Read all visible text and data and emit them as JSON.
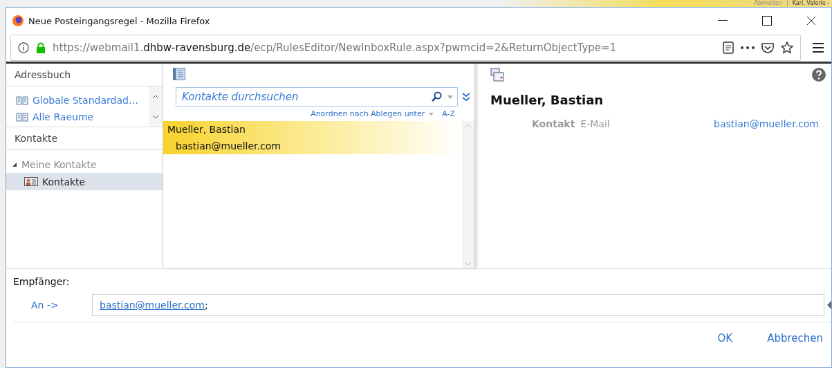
{
  "background_header": {
    "items": [
      "Abmelden",
      "|",
      "Karl, Valerie -"
    ]
  },
  "window": {
    "title": "Neue Posteingangsregel - Mozilla Firefox"
  },
  "address_bar": {
    "url_scheme": "https://webmail1.",
    "url_domain": "dhbw-ravensburg.de",
    "url_path": "/ecp/RulesEditor/NewInboxRule.aspx?pwmcid=2&ReturnObjectType=1"
  },
  "address_book": {
    "title": "Adressbuch",
    "items": [
      {
        "label": "Globale Standardad…",
        "selected": false
      },
      {
        "label": "Alle Raeume",
        "selected": false
      }
    ]
  },
  "contacts": {
    "title": "Kontakte",
    "tree": [
      {
        "label": "Meine Kontakte",
        "expanded": true,
        "selected": false,
        "children": [
          {
            "label": "Kontakte",
            "selected": true
          }
        ]
      }
    ]
  },
  "search": {
    "placeholder": "Kontakte durchsuchen"
  },
  "sort": {
    "label": "Anordnen nach Ablegen unter",
    "order": "A-Z"
  },
  "results": [
    {
      "name": "Mueller, Bastian",
      "email": "bastian@mueller.com",
      "selected": true
    }
  ],
  "detail": {
    "name": "Mueller, Bastian",
    "section": "Kontakt",
    "field": "E-Mail",
    "value": "bastian@mueller.com"
  },
  "recipients": {
    "label": "Empfänger:",
    "button": "An ->",
    "value": "bastian@mueller.com",
    "separator": ";"
  },
  "buttons": [
    "OK",
    "Abbrechen"
  ]
}
